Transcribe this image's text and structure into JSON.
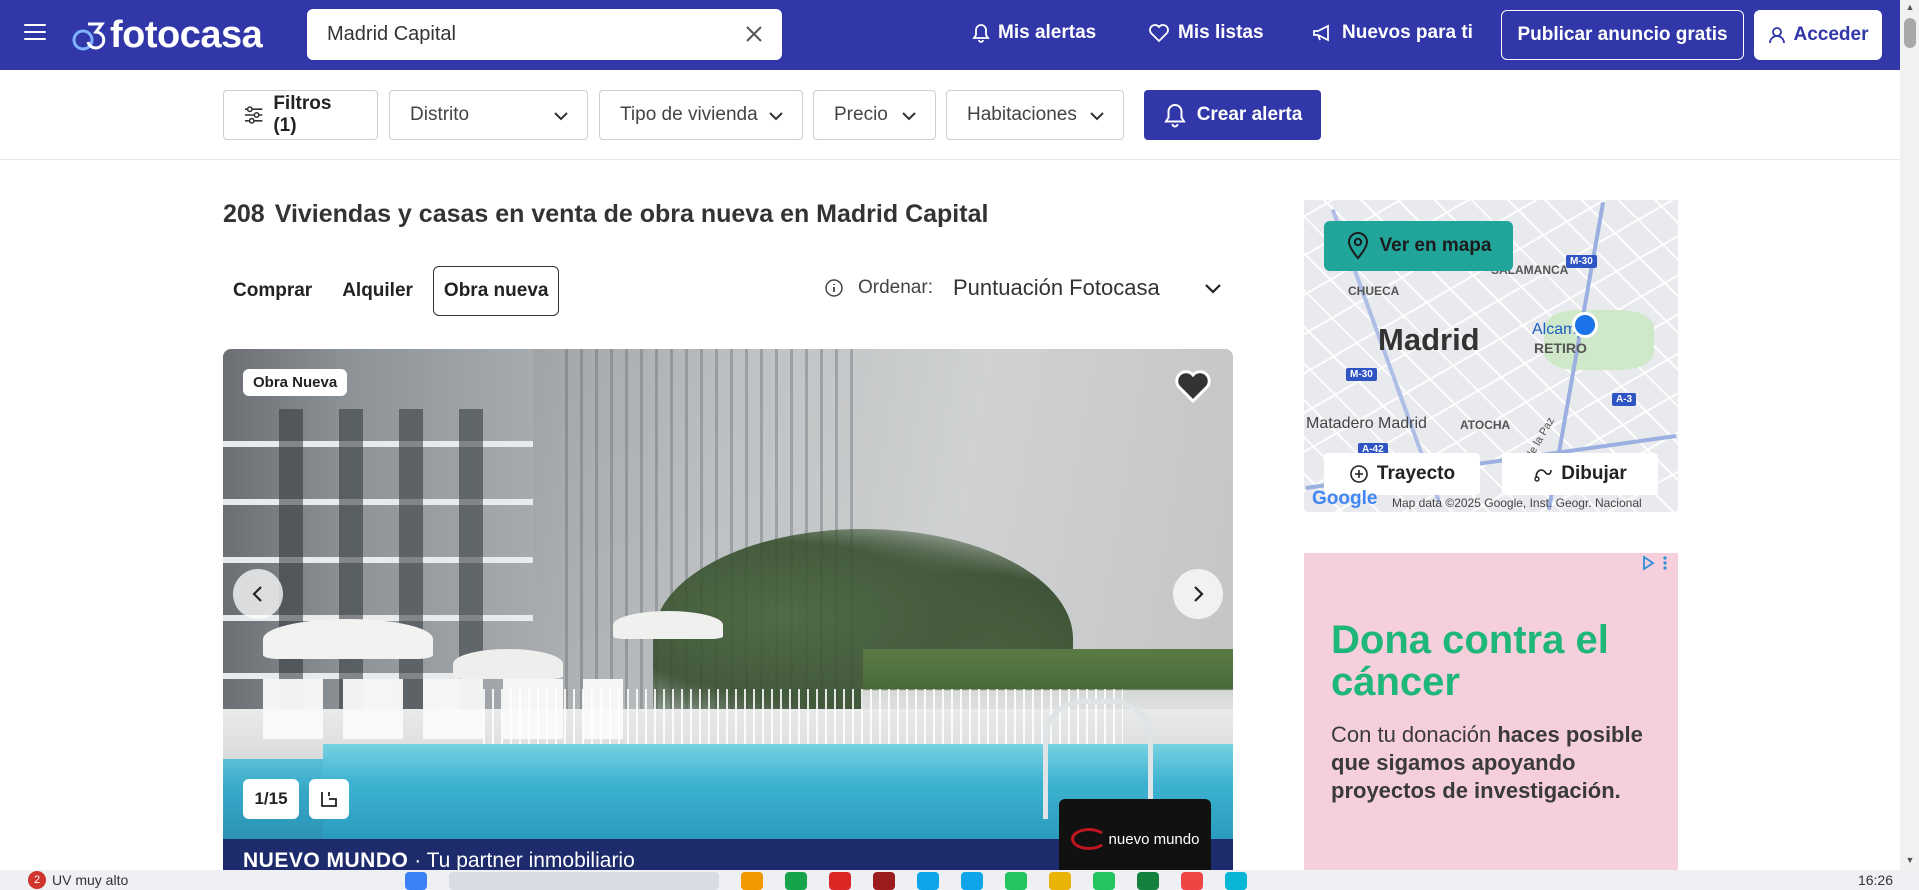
{
  "header": {
    "brand": "fotocasa",
    "search_value": "Madrid Capital",
    "nav": {
      "alerts": "Mis alertas",
      "lists": "Mis listas",
      "new_for_you": "Nuevos para ti"
    },
    "publish_label": "Publicar anuncio gratis",
    "login_label": "Acceder"
  },
  "filters": {
    "filtros": "Filtros (1)",
    "distrito": "Distrito",
    "tipo": "Tipo de vivienda",
    "precio": "Precio",
    "habitaciones": "Habitaciones",
    "crear_alerta": "Crear alerta"
  },
  "results": {
    "count": "208",
    "title": "Viviendas y casas en venta de obra nueva en Madrid Capital"
  },
  "tabs": [
    {
      "label": "Comprar",
      "active": false
    },
    {
      "label": "Alquiler",
      "active": false
    },
    {
      "label": "Obra nueva",
      "active": true
    }
  ],
  "order": {
    "label": "Ordenar:",
    "value": "Puntuación Fotocasa"
  },
  "listing": {
    "badge": "Obra Nueva",
    "photo_counter": "1/15",
    "agency_name": "NUEVO MUNDO",
    "agency_tagline": "· Tu partner inmobiliario",
    "agency_logo_text": "nuevo mundo"
  },
  "map": {
    "view_button": "Ver en mapa",
    "route_button": "Trayecto",
    "draw_button": "Dibujar",
    "labels": {
      "city": "Madrid",
      "chueca": "CHUECA",
      "salamanca": "SALAMANCA",
      "retiro": "RETIRO",
      "alcampo": "Alcampo",
      "atocha": "ATOCHA",
      "matadero": "Matadero Madrid",
      "street": "Av. de la Paz"
    },
    "highways": [
      "M-30",
      "M-30",
      "A-3",
      "A-42"
    ],
    "google": "Google",
    "attribution": "Map data ©2025 Google, Inst. Geogr. Nacional"
  },
  "ad": {
    "headline": "Dona contra el cáncer",
    "body_pre": "Con tu donación ",
    "body_bold": "haces posible que sigamos apoyando proyectos de investigación.",
    "headline_color": "#1fb67a"
  },
  "taskbar": {
    "badge_count": "2",
    "notification": "UV muy alto",
    "clock": "16:26"
  },
  "colors": {
    "brand": "#3136a8",
    "map_button": "#21a59b",
    "ad_background": "#f6cfdc"
  }
}
